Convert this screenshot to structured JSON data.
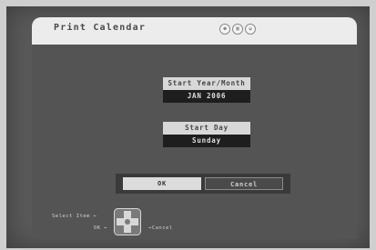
{
  "window": {
    "title": "Print Calendar",
    "icons": [
      "disc-icon",
      "sd-card-icon",
      "hdd-icon"
    ]
  },
  "fields": {
    "start_year_month": {
      "label": "Start Year/Month",
      "value": "JAN 2006"
    },
    "start_day": {
      "label": "Start Day",
      "value": "Sunday"
    }
  },
  "buttons": {
    "ok": "OK",
    "cancel": "Cancel"
  },
  "help": {
    "select_item": "Select Item",
    "ok": "OK",
    "cancel": "Cancel"
  }
}
